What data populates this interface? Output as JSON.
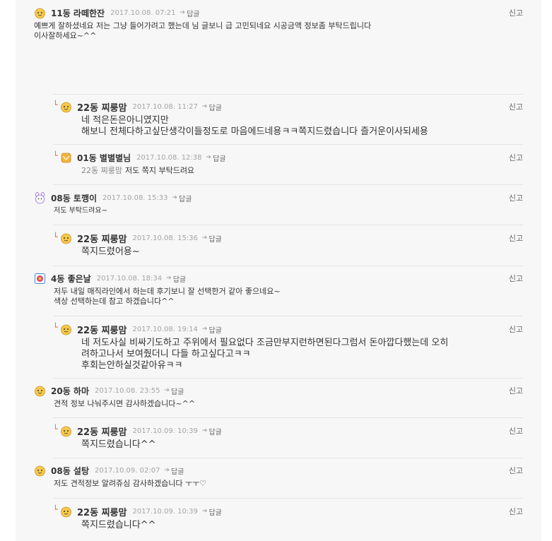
{
  "report_label": "신고",
  "reply_label": "답글",
  "comments": [
    {
      "nick": "11동 라떼한잔",
      "date": "2017.10.08. 07:21",
      "lines": [
        "예쁘게 잘하셨네요 저는 그냥 들어가려고 했는데 님 글보니 급 고민되네요 시공금액 정보좀 부탁드립니다",
        "이사잘하세요~^^"
      ]
    },
    {
      "nick": "22동 찌룽맘",
      "date": "2017.10.08. 11:27",
      "lines": [
        "네 적은돈은아니였지만",
        "해보니 전체다하고싶단생각이들정도로 마음에드네용ㅋㅋ쪽지드렸습니다 즐거운이사되세용"
      ]
    },
    {
      "nick": "01동 별별별님",
      "date": "2017.10.08. 12:38",
      "mention": "22동 찌룽맘",
      "lines": [
        "저도 쪽지 부탁드려요"
      ]
    },
    {
      "nick": "08동 토깽이",
      "date": "2017.10.08. 15:33",
      "lines": [
        "저도 부탁드려요~"
      ]
    },
    {
      "nick": "22동 찌룽맘",
      "date": "2017.10.08. 15:36",
      "lines": [
        "쪽지드렸어용~"
      ]
    },
    {
      "nick": "4동 좋은날",
      "date": "2017.10.08. 18:34",
      "lines": [
        "저두 내일 매직라인에서 하는데 후기보니 잘 선택한거 같아 좋으네요~",
        "색상 선택하는데 참고 하겠습니다^^"
      ]
    },
    {
      "nick": "22동 찌룽맘",
      "date": "2017.10.08. 19:14",
      "lines": [
        "네 저도사실 비싸기도하고 주위에서 필요없다 조금만부지런하면된다그럼서 돈아깝다했는데 오히",
        "려하고나서 보여줬더니 다들 하고싶다고ㅋㅋ",
        "후회는안하실것같아유ㅋㅋ"
      ]
    },
    {
      "nick": "20동 하마",
      "date": "2017.10.08. 23:55",
      "lines": [
        "견적 정보 나눠주시면 감사하겠습니다~^^"
      ]
    },
    {
      "nick": "22동 찌룽맘",
      "date": "2017.10.09. 10:39",
      "lines": [
        "쪽지드렸습니다^^"
      ]
    },
    {
      "nick": "08동 설탕",
      "date": "2017.10.09. 02:07",
      "lines": [
        "저도 견적정보 알려쥬심 감사하겠습니다 ㅜㅜ♡"
      ]
    },
    {
      "nick": "22동 찌룽맘",
      "date": "2017.10.09. 10:39",
      "lines": [
        "쪽지드렸습니다^^"
      ]
    }
  ]
}
